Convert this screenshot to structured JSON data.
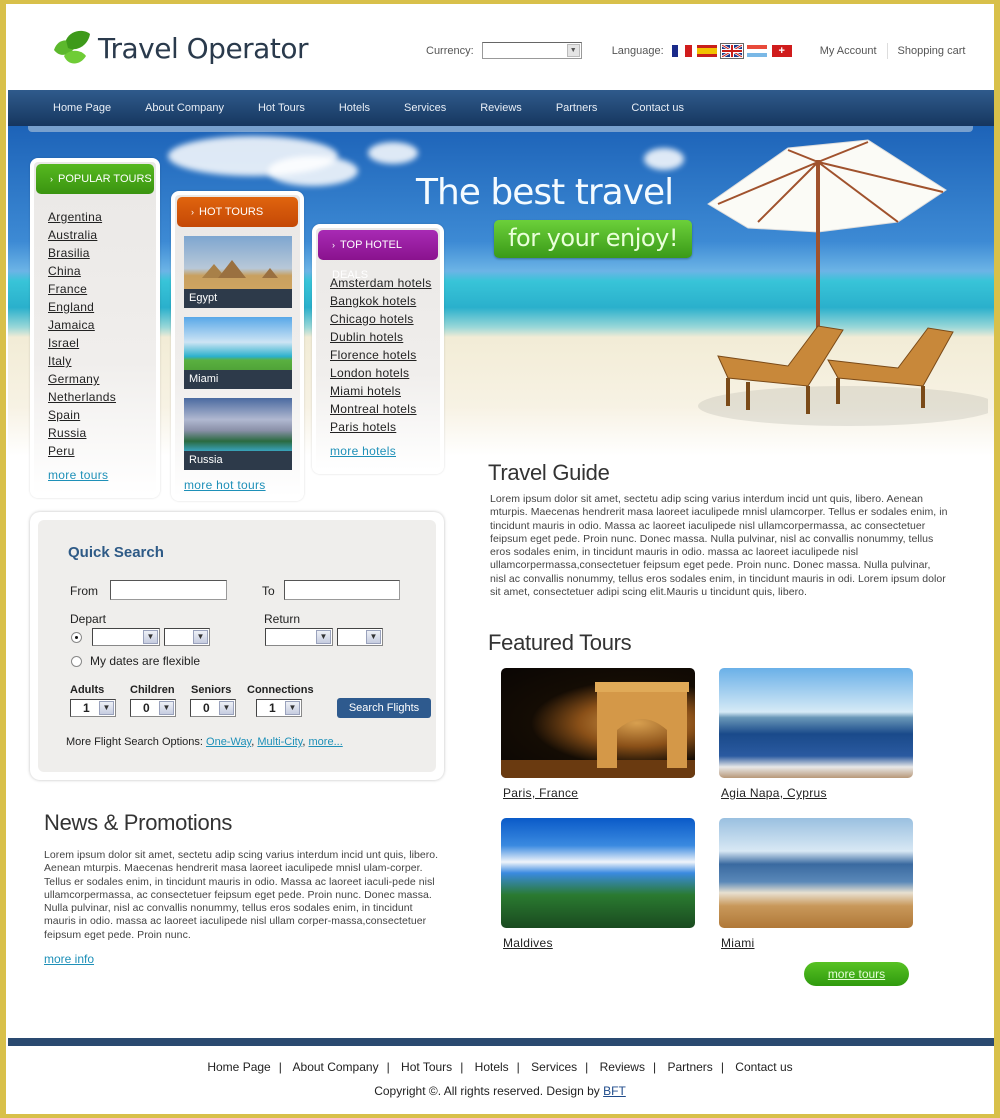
{
  "brand": {
    "name": "Travel Operator"
  },
  "header": {
    "currency_label": "Currency:",
    "currency_value": "",
    "language_label": "Language:",
    "languages": [
      {
        "code": "fr",
        "icon": "flag-france-icon"
      },
      {
        "code": "es",
        "icon": "flag-spain-icon"
      },
      {
        "code": "en",
        "icon": "flag-uk-icon",
        "selected": true
      },
      {
        "code": "nl",
        "icon": "flag-light-blue-icon"
      },
      {
        "code": "ch",
        "icon": "flag-switzerland-icon"
      }
    ],
    "my_account": "My Account",
    "shopping_cart": "Shopping cart"
  },
  "nav": {
    "items": [
      "Home Page",
      "About Company",
      "Hot Tours",
      "Hotels",
      "Services",
      "Reviews",
      "Partners",
      "Contact us"
    ]
  },
  "hero": {
    "line1": "The best travel",
    "line2": "for your enjoy!"
  },
  "popular_tours": {
    "title": "POPULAR TOURS",
    "color": "#3f9e12",
    "items": [
      "Argentina",
      "Australia",
      "Brasilia",
      "China",
      "France",
      "England",
      "Jamaica",
      "Israel",
      "Italy",
      "Germany",
      "Netherlands",
      "Spain",
      "Russia",
      "Peru"
    ],
    "more": "more tours"
  },
  "hot_tours": {
    "title": "HOT TOURS",
    "color": "#d4530a",
    "items": [
      "Egypt",
      "Miami",
      "Russia"
    ],
    "more": "more hot tours"
  },
  "hotel_deals": {
    "title": "TOP HOTEL DEALS",
    "color": "#9a1aa6",
    "items": [
      "Amsterdam hotels",
      "Bangkok hotels",
      "Chicago hotels",
      "Dublin hotels",
      "Florence hotels",
      "London hotels",
      "Miami hotels",
      "Montreal hotels",
      "Paris hotels"
    ],
    "more": "more hotels"
  },
  "quick_search": {
    "title": "Quick Search",
    "from_label": "From",
    "from_value": "",
    "to_label": "To",
    "to_value": "",
    "depart_label": "Depart",
    "return_label": "Return",
    "flexible_label": "My dates are flexible",
    "adults_label": "Adults",
    "adults_value": "1",
    "children_label": "Children",
    "children_value": "0",
    "seniors_label": "Seniors",
    "seniors_value": "0",
    "connections_label": "Connections",
    "connections_value": "1",
    "search_button": "Search Flights",
    "more_options_label": "More Flight Search Options:",
    "more_options": [
      "One-Way",
      "Multi-City",
      "more..."
    ]
  },
  "travel_guide": {
    "title": "Travel Guide",
    "text": "Lorem ipsum dolor sit amet, sectetu adip scing varius interdum incid unt quis, libero. Aenean mturpis. Maecenas hendrerit masa laoreet iaculipede mnisl ulamcorper. Tellus er sodales enim, in tincidunt mauris in odio. Massa ac laoreet iaculipede nisl ullamcorpermassa, ac consectetuer feipsum eget pede. Proin nunc. Donec massa. Nulla pulvinar, nisl ac convallis nonummy, tellus eros sodales enim, in tincidunt mauris in odio. massa ac laoreet iaculipede nisl ullamcorpermassa,consectetuer feipsum eget pede. Proin nunc. Donec massa. Nulla pulvinar, nisl ac convallis nonummy, tellus eros sodales enim, in tincidunt mauris in odi. Lorem ipsum dolor sit amet, consectetuer adipi scing elit.Mauris u tincidunt quis, libero."
  },
  "featured_tours": {
    "title": "Featured Tours",
    "items": [
      "Paris, France",
      "Agia Napa, Cyprus",
      "Maldives",
      "Miami"
    ],
    "more": "more tours"
  },
  "news": {
    "title": "News & Promotions",
    "text": "Lorem ipsum dolor sit amet, sectetu adip scing varius interdum incid unt quis, libero. Aenean mturpis. Maecenas hendrerit masa laoreet iaculipede mnisl ulam-corper. Tellus er sodales enim, in tincidunt mauris in odio. Massa ac laoreet iaculi-pede nisl ullamcorpermassa, ac consectetuer feipsum eget pede. Proin nunc. Donec massa. Nulla pulvinar, nisl ac convallis nonummy, tellus eros sodales enim, in tincidunt mauris in odio. massa ac laoreet iaculipede nisl ullam corper-massa,consectetuer feipsum eget pede. Proin nunc.",
    "more": "more info"
  },
  "footer": {
    "links": [
      "Home Page",
      "About Company",
      "Hot Tours",
      "Hotels",
      "Services",
      "Reviews",
      "Partners",
      "Contact us"
    ],
    "copyright": "Copyright ©. All rights reserved. Design by ",
    "designer": "BFT"
  }
}
